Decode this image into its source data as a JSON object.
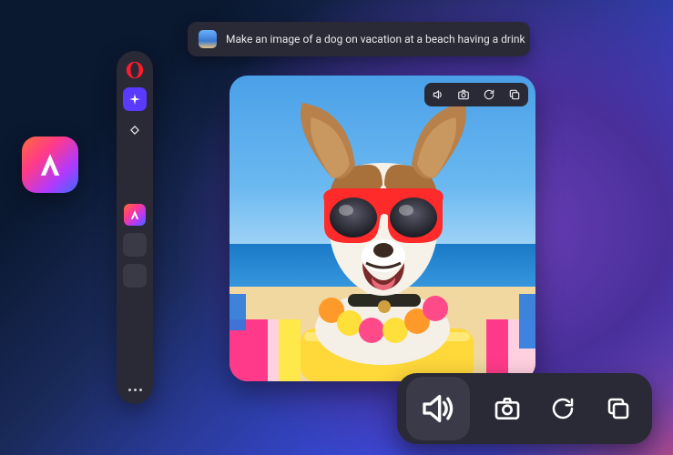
{
  "prompt": {
    "text": "Make an image of a dog on vacation at a beach having a drink"
  },
  "sidebar": {
    "items": [
      {
        "name": "opera-logo"
      },
      {
        "name": "sparkle"
      },
      {
        "name": "diamond"
      },
      {
        "name": "aria-logo"
      },
      {
        "name": "empty-slot"
      },
      {
        "name": "empty-slot"
      }
    ]
  },
  "image_toolbar": {
    "buttons": [
      "speaker",
      "camera",
      "refresh",
      "copy"
    ]
  },
  "main_toolbar": {
    "buttons": [
      "speaker",
      "camera",
      "refresh",
      "copy"
    ],
    "active": "speaker"
  },
  "colors": {
    "panel": "#2a2a36",
    "accent": "#5a3aff"
  }
}
